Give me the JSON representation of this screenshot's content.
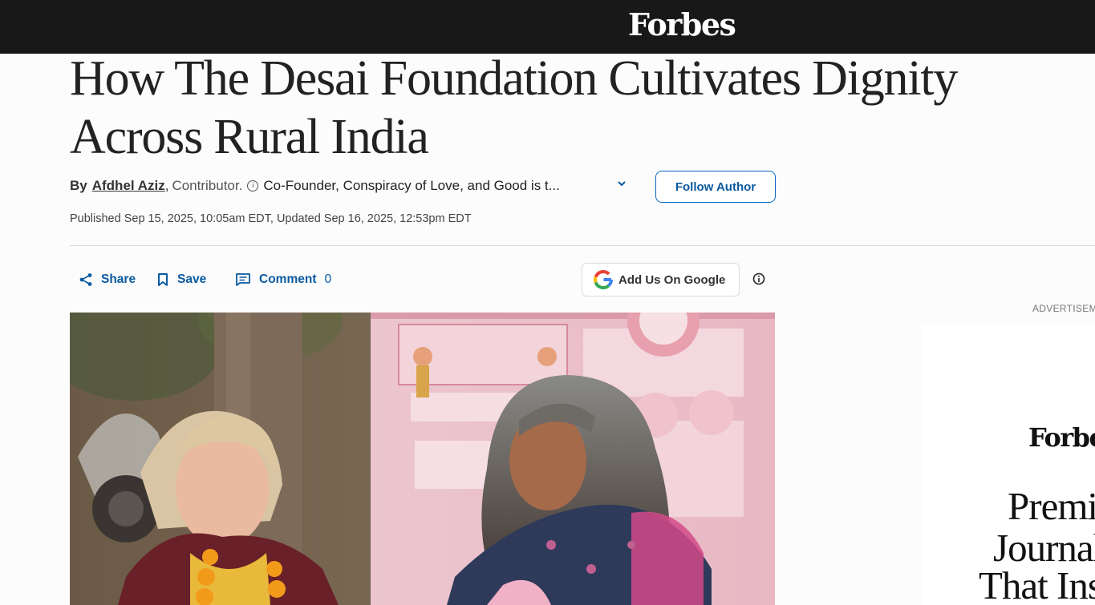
{
  "header": {
    "logo": "Forbes"
  },
  "article": {
    "headline": "How The Desai Foundation Cultivates Dignity Across Rural India",
    "byline": {
      "by": "By",
      "author": "Afdhel Aziz",
      "comma": ",",
      "role": "Contributor.",
      "bio": "Co-Founder, Conspiracy of Love, and Good is t...",
      "follow_label": "Follow Author"
    },
    "published": "Published Sep 15, 2025, 10:05am EDT, Updated Sep 16, 2025, 12:53pm EDT"
  },
  "actions": {
    "share": "Share",
    "save": "Save",
    "comment": "Comment",
    "comment_count": "0",
    "google": "Add Us On Google"
  },
  "ad": {
    "label": "ADVERTISEMENT",
    "logo": "Forbes",
    "lines": [
      "Premium",
      "Journalism",
      "That Inspires"
    ]
  },
  "colors": {
    "topbar": "#181818",
    "accent": "#0a5aa0"
  },
  "icons": [
    "share-icon",
    "bookmark-icon",
    "comment-icon",
    "google-icon",
    "info-icon",
    "chevron-down-icon"
  ]
}
